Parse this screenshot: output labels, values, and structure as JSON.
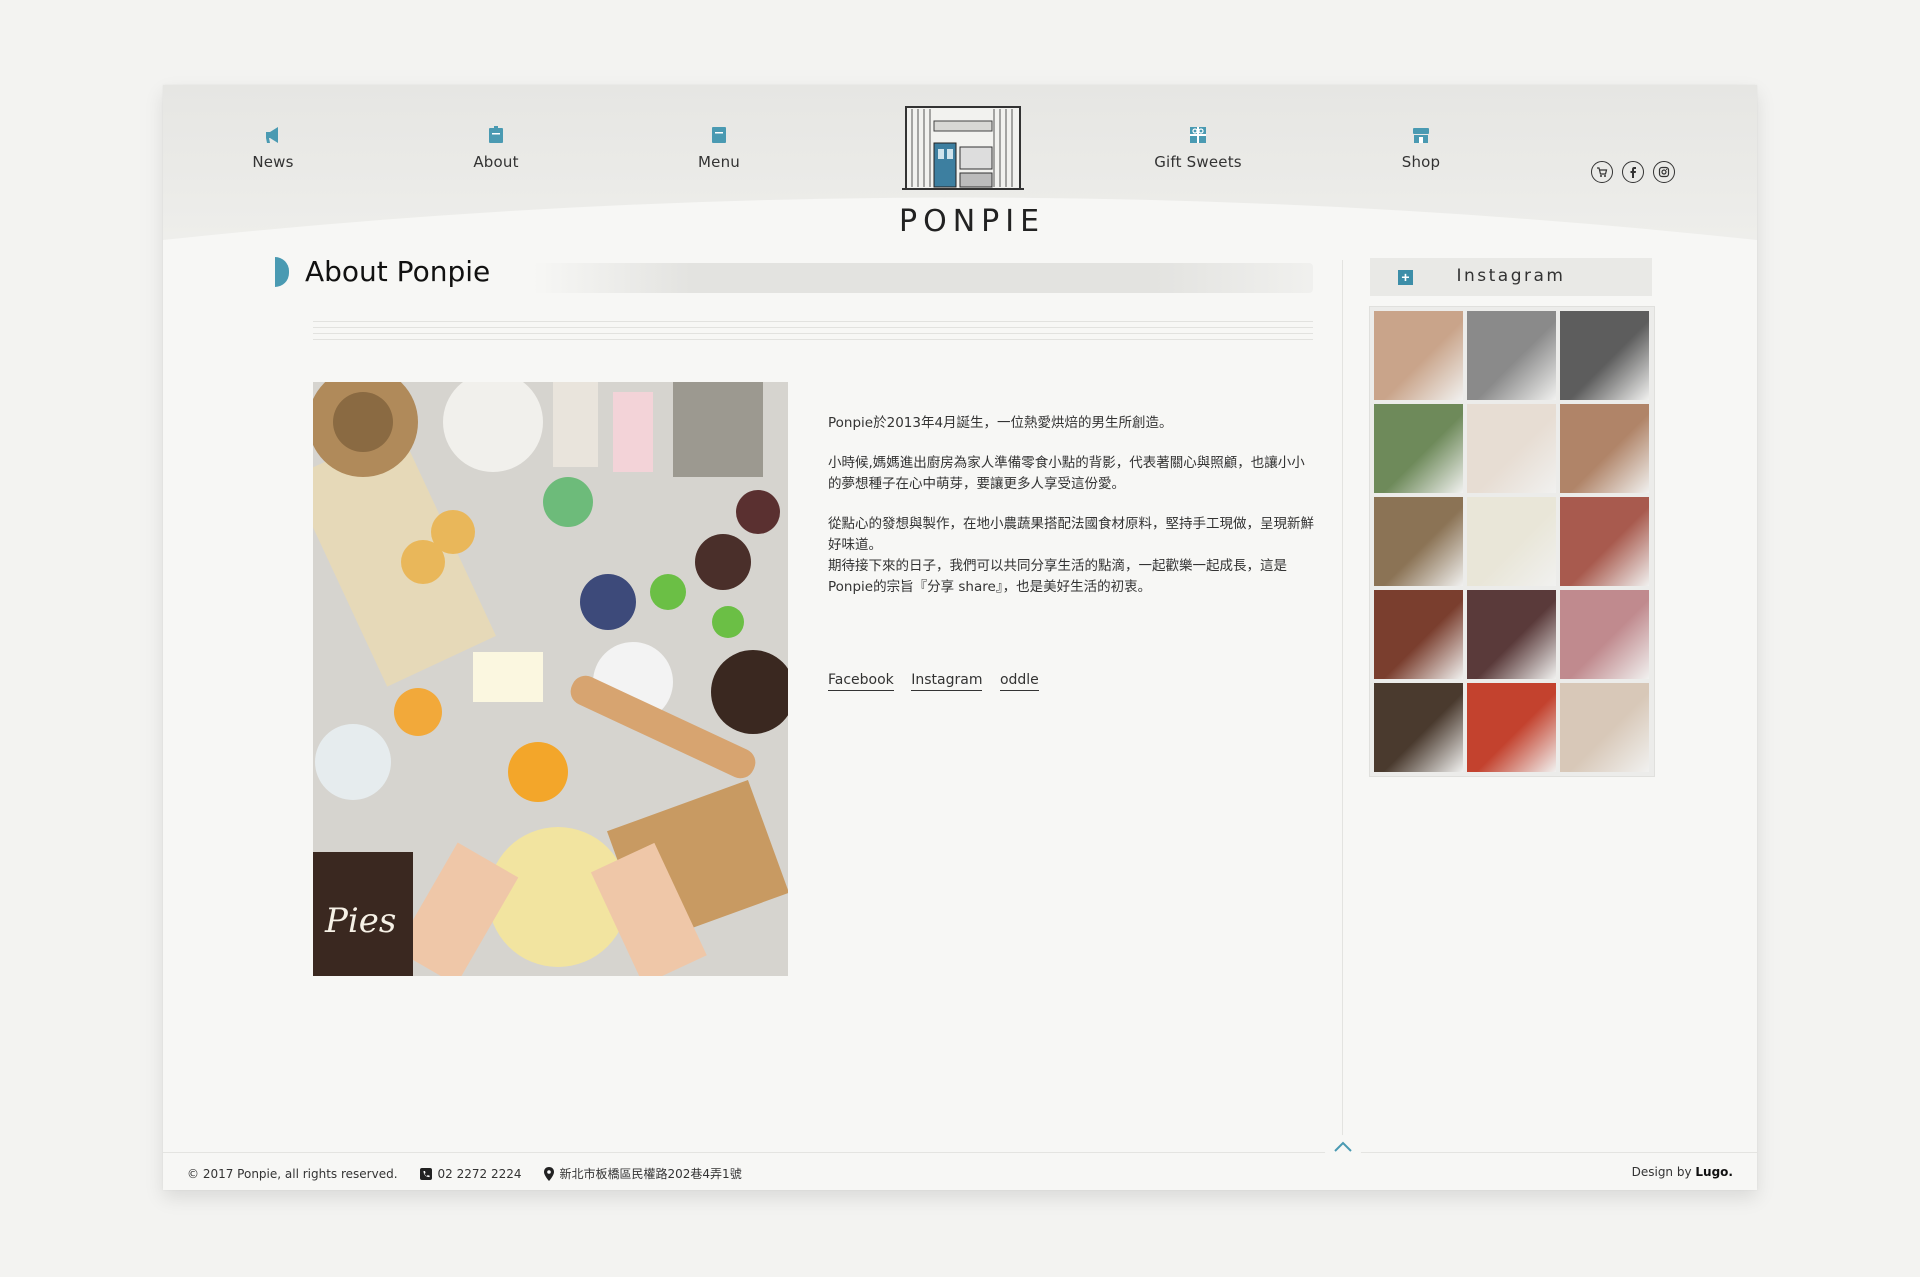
{
  "nav": {
    "items": [
      {
        "label": "News",
        "icon": "megaphone-icon"
      },
      {
        "label": "About",
        "icon": "book-icon"
      },
      {
        "label": "Menu",
        "icon": "menu-book-icon"
      },
      {
        "label": "Gift Sweets",
        "icon": "gift-icon"
      },
      {
        "label": "Shop",
        "icon": "shop-icon"
      }
    ],
    "social": [
      "cart-icon",
      "facebook-icon",
      "instagram-icon"
    ]
  },
  "brand": {
    "name": "PONPIE"
  },
  "page": {
    "title": "About Ponpie",
    "paragraphs": [
      "Ponpie於2013年4月誕生，一位熱愛烘焙的男生所創造。",
      "小時候,媽媽進出廚房為家人準備零食小點的背影，代表著關心與照顧，也讓小小的夢想種子在心中萌芽，要讓更多人享受這份愛。",
      "從點心的發想與製作，在地小農蔬果搭配法國食材原料，堅持手工現做，呈現新鮮好味道。",
      "期待接下來的日子，我們可以共同分享生活的點滴，一起歡樂一起成長，這是Ponpie的宗旨『分享 share』，也是美好生活的初衷。"
    ],
    "links": [
      "Facebook",
      "Instagram",
      "oddle"
    ]
  },
  "sidebar": {
    "title": "Instagram",
    "tile_colors": [
      "#c9a48a",
      "#8a8a8a",
      "#5d5d5d",
      "#6e8a5a",
      "#e7ddd3",
      "#b08468",
      "#8b7355",
      "#e9e6d8",
      "#a85a4e",
      "#7a3e2e",
      "#5a3a3a",
      "#c08a8e",
      "#4a3a2e",
      "#c3422e",
      "#d8c8b8"
    ]
  },
  "footer": {
    "copyright": "© 2017 Ponpie, all rights reserved.",
    "phone": "02 2272 2224",
    "address": "新北市板橋區民權路202巷4弄1號",
    "design_prefix": "Design by",
    "design_by": "Lugo."
  },
  "colors": {
    "accent": "#4a9ab2",
    "page_bg": "#f7f7f5",
    "outer_bg": "#f3f3f1"
  }
}
